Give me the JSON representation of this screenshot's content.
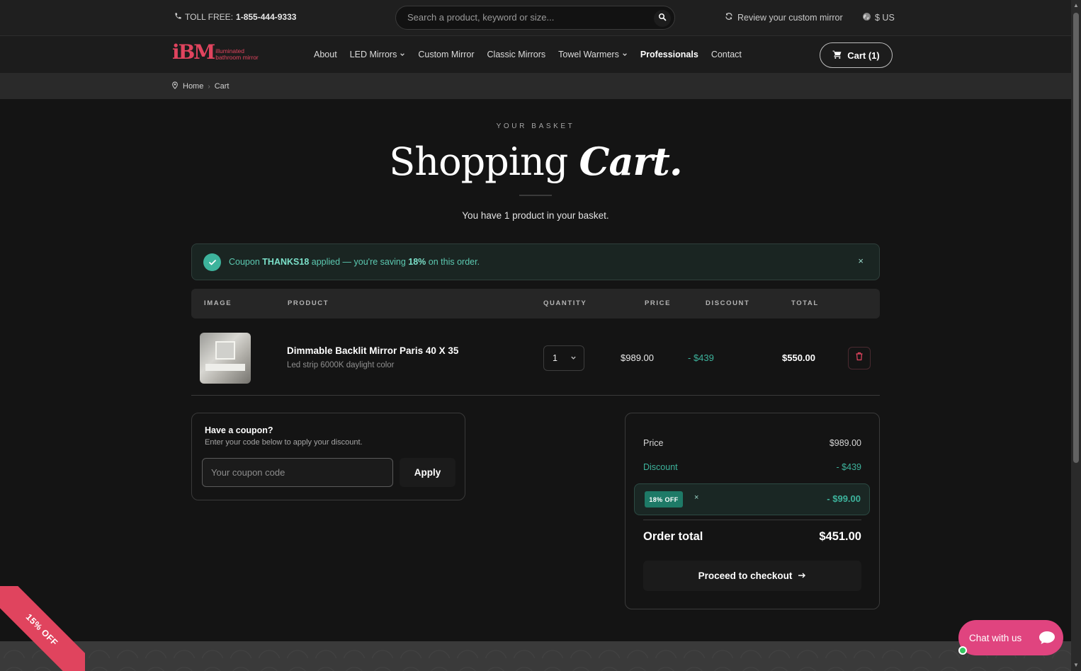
{
  "topbar": {
    "toll_label": "TOLL FREE:",
    "toll_number": "1-855-444-9333",
    "search_placeholder": "Search a product, keyword or size...",
    "review_label": "Review your custom mirror",
    "currency": "$ US"
  },
  "logo": {
    "mark": "iBM",
    "line1": "illuminated",
    "line2": "bathroom mirror"
  },
  "nav": {
    "items": [
      "About",
      "LED Mirrors",
      "Custom Mirror",
      "Classic Mirrors",
      "Towel Warmers",
      "Professionals",
      "Contact"
    ],
    "cart_label": "Cart (1)"
  },
  "breadcrumb": {
    "home": "Home",
    "current": "Cart"
  },
  "heading": {
    "eyebrow": "YOUR BASKET",
    "title_plain": "Shopping",
    "title_emph": "Cart.",
    "subtitle": "You have 1 product in your basket."
  },
  "alert": {
    "prefix": "Coupon",
    "code": "THANKS18",
    "middle": "applied — you're saving",
    "percent": "18%",
    "suffix": "on this order.",
    "close": "×"
  },
  "table": {
    "headers": [
      "IMAGE",
      "PRODUCT",
      "QUANTITY",
      "PRICE",
      "DISCOUNT",
      "TOTAL"
    ],
    "rows": [
      {
        "name": "Dimmable Backlit Mirror Paris 40 X 35",
        "variant": "Led strip 6000K daylight color",
        "quantity": "1",
        "price": "$989.00",
        "discount": "- $439",
        "total": "$550.00"
      }
    ]
  },
  "coupon_box": {
    "title": "Have a coupon?",
    "subtitle": "Enter your code below to apply your discount.",
    "placeholder": "Your coupon code",
    "apply": "Apply"
  },
  "summary": {
    "price_label": "Price",
    "price_value": "$989.00",
    "discount_label": "Discount",
    "discount_value": "- $439",
    "promo_tag": "18% OFF",
    "promo_remove": "×",
    "promo_amount": "- $99.00",
    "total_label": "Order total",
    "total_value": "$451.00",
    "checkout": "Proceed to checkout"
  },
  "ribbon": "15% OFF",
  "chat": "Chat with us",
  "colors": {
    "accent": "#e0445e",
    "teal": "#3db39c",
    "chat": "#e0447f"
  }
}
